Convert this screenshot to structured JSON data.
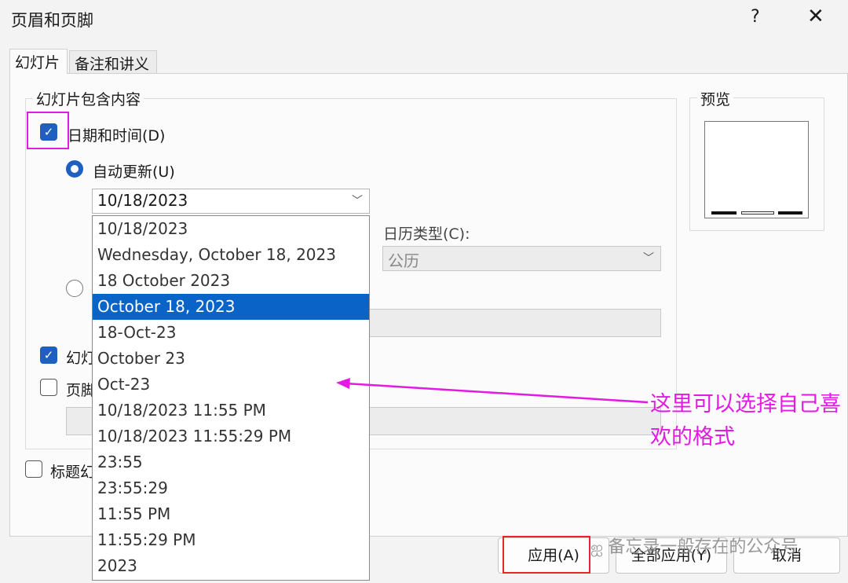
{
  "dialog": {
    "title": "页眉和页脚",
    "help": "?",
    "close": "✕"
  },
  "tabs": [
    {
      "label": "幻灯片",
      "active": true
    },
    {
      "label": "备注和讲义",
      "active": false
    }
  ],
  "group": {
    "title": "幻灯片包含内容",
    "date_time": {
      "label": "日期和时间(D)",
      "checked": true
    },
    "auto_update": {
      "label": "自动更新(U)",
      "selected": true
    },
    "date_combo": {
      "value": "10/18/2023"
    },
    "calendar": {
      "label": "日历类型(C):",
      "value": "公历"
    },
    "slide_number": {
      "label": "幻灯",
      "checked": true
    },
    "footer": {
      "label": "页脚",
      "checked": false
    }
  },
  "title_slide": {
    "label": "标题幻",
    "checked": false
  },
  "dropdown": {
    "options": [
      "10/18/2023",
      "Wednesday, October 18, 2023",
      "18 October 2023",
      "October 18, 2023",
      "18-Oct-23",
      "October 23",
      "Oct-23",
      "10/18/2023 11:55 PM",
      "10/18/2023 11:55:29 PM",
      "23:55",
      "23:55:29",
      "11:55 PM",
      "11:55:29 PM",
      "2023"
    ],
    "selected_index": 3
  },
  "preview": {
    "title": "预览"
  },
  "buttons": {
    "apply": "应用(A)",
    "apply_all": "全部应用(Y)",
    "cancel": "取消"
  },
  "annotation": {
    "text": "这里可以选择自己喜欢的格式",
    "color": "#e21ae2"
  },
  "watermark": "备忘录一般存在的公众号",
  "colors": {
    "accent": "#1f5fbf",
    "selection": "#0a64c8",
    "highlight_magenta": "#e21ae2",
    "highlight_red": "#e8242c"
  }
}
